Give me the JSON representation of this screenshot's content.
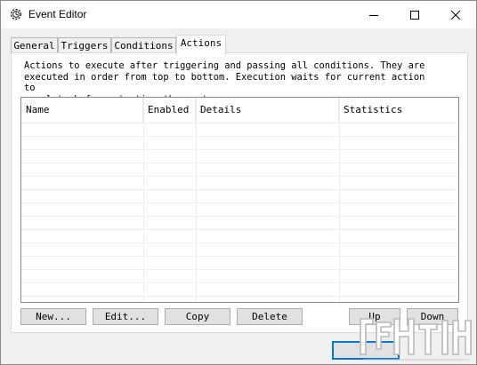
{
  "window": {
    "title": "Event Editor",
    "icon": "gear-icon",
    "controls": [
      "minimize-icon",
      "maximize-icon",
      "close-icon"
    ]
  },
  "tabs": [
    {
      "label": "General",
      "active": false
    },
    {
      "label": "Triggers",
      "active": false
    },
    {
      "label": "Conditions",
      "active": false
    },
    {
      "label": "Actions",
      "active": true
    }
  ],
  "actions_tab": {
    "description_lines": [
      "Actions to execute after triggering and passing all conditions. They are",
      "executed in order from top to bottom. Execution waits for current action to",
      "complete before starting the next one."
    ],
    "list": {
      "columns": [
        "Name",
        "Enabled",
        "Details",
        "Statistics"
      ],
      "rows": []
    },
    "buttons": {
      "new": "New...",
      "edit": "Edit...",
      "copy": "Copy",
      "delete": "Delete",
      "up": "Up",
      "down": "Down"
    }
  },
  "colors": {
    "focus_border": "#0078d7",
    "button_face": "#e1e1e1",
    "dialog_bg": "#f0f0f0"
  }
}
